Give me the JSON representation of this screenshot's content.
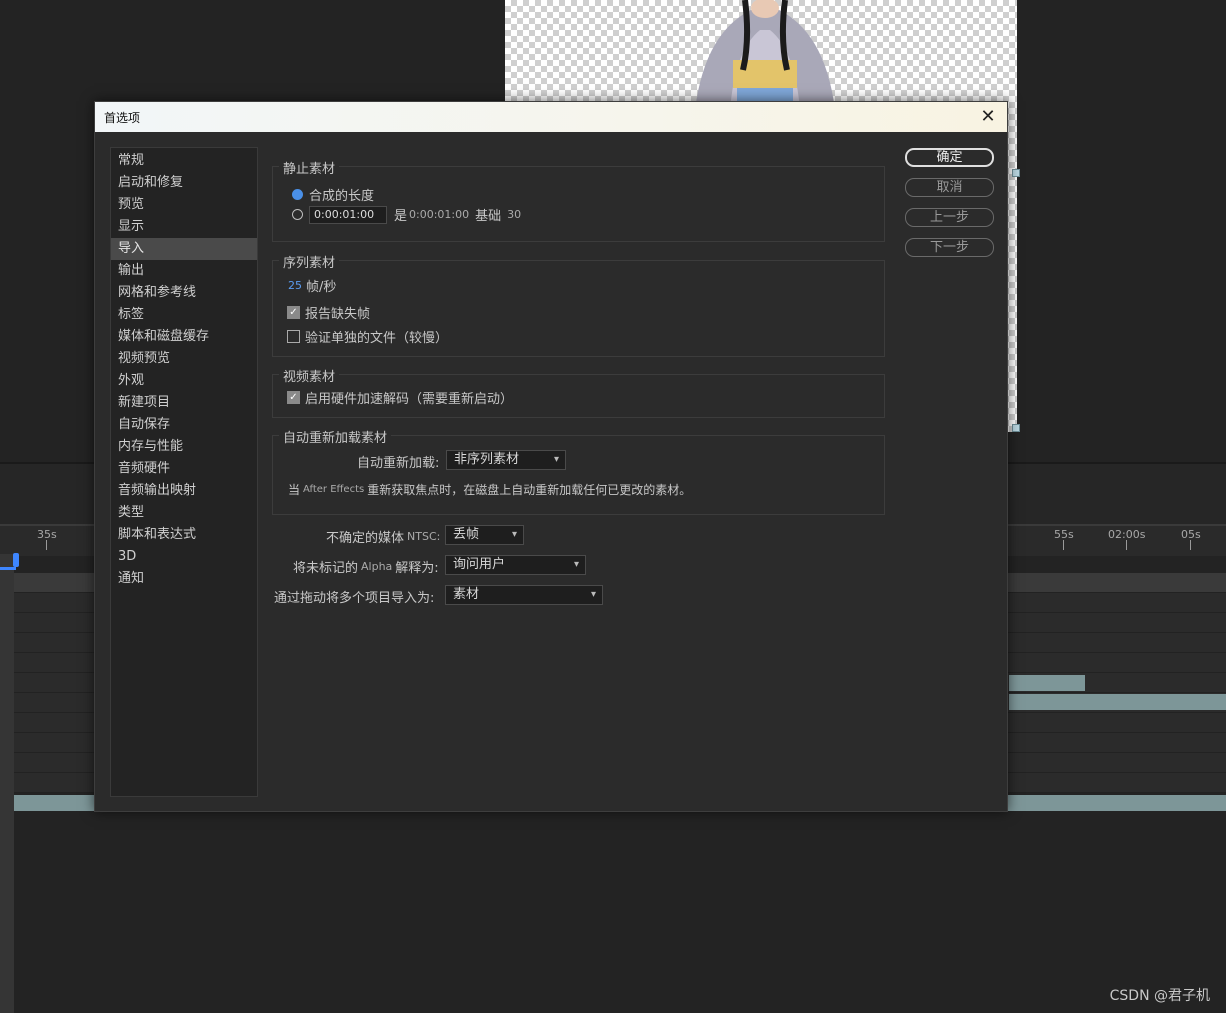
{
  "dialog": {
    "title": "首选项",
    "close_glyph": "✕"
  },
  "sidebar": {
    "items": [
      {
        "label": "常规",
        "active": false
      },
      {
        "label": "启动和修复",
        "active": false
      },
      {
        "label": "预览",
        "active": false
      },
      {
        "label": "显示",
        "active": false
      },
      {
        "label": "导入",
        "active": true
      },
      {
        "label": "输出",
        "active": false
      },
      {
        "label": "网格和参考线",
        "active": false
      },
      {
        "label": "标签",
        "active": false
      },
      {
        "label": "媒体和磁盘缓存",
        "active": false
      },
      {
        "label": "视频预览",
        "active": false
      },
      {
        "label": "外观",
        "active": false
      },
      {
        "label": "新建项目",
        "active": false
      },
      {
        "label": "自动保存",
        "active": false
      },
      {
        "label": "内存与性能",
        "active": false
      },
      {
        "label": "音频硬件",
        "active": false
      },
      {
        "label": "音频输出映射",
        "active": false
      },
      {
        "label": "类型",
        "active": false
      },
      {
        "label": "脚本和表达式",
        "active": false
      },
      {
        "label": "3D",
        "active": false
      },
      {
        "label": "通知",
        "active": false
      }
    ]
  },
  "still_footage": {
    "title": "静止素材",
    "radio_comp_length": {
      "label": "合成的长度",
      "selected": true
    },
    "radio_custom": {
      "selected": false
    },
    "duration_value": "0:00:01:00",
    "is_label": "是",
    "is_value": "0:00:01:00",
    "base_label": "基础",
    "base_value": "30"
  },
  "sequence_footage": {
    "title": "序列素材",
    "fps_value": "25",
    "fps_unit": "帧/秒",
    "report_missing": {
      "label": "报告缺失帧",
      "checked": true
    },
    "verify_files": {
      "label": "验证单独的文件（较慢）",
      "checked": false
    }
  },
  "video_footage": {
    "title": "视频素材",
    "hw_decode": {
      "label": "启用硬件加速解码（需要重新启动）",
      "checked": true
    }
  },
  "auto_reload": {
    "title": "自动重新加载素材",
    "label": "自动重新加载:",
    "value": "非序列素材",
    "note_prefix": "当",
    "note_app": "After Effects",
    "note_suffix": "重新获取焦点时，在磁盘上自动重新加载任何已更改的素材。"
  },
  "ntsc": {
    "label_prefix": "不确定的媒体",
    "label_tag": "NTSC:",
    "value": "丢帧"
  },
  "alpha": {
    "label_prefix": "将未标记的",
    "label_tag": "Alpha",
    "label_suffix": "解释为:",
    "value": "询问用户"
  },
  "drag_import": {
    "label": "通过拖动将多个项目导入为:",
    "value": "素材"
  },
  "buttons": {
    "ok": "确定",
    "cancel": "取消",
    "prev": "上一步",
    "next": "下一步"
  },
  "timeline": {
    "ruler_labels": [
      "35s",
      "55s",
      "02:00s",
      "05s"
    ]
  },
  "watermark": "CSDN @君子机",
  "colors": {
    "accent_blue": "#4a90e8",
    "dialog_bg": "#2b2b2b",
    "titlebar_bg": "#f5f5ee",
    "track_clip": "#7d9698"
  }
}
